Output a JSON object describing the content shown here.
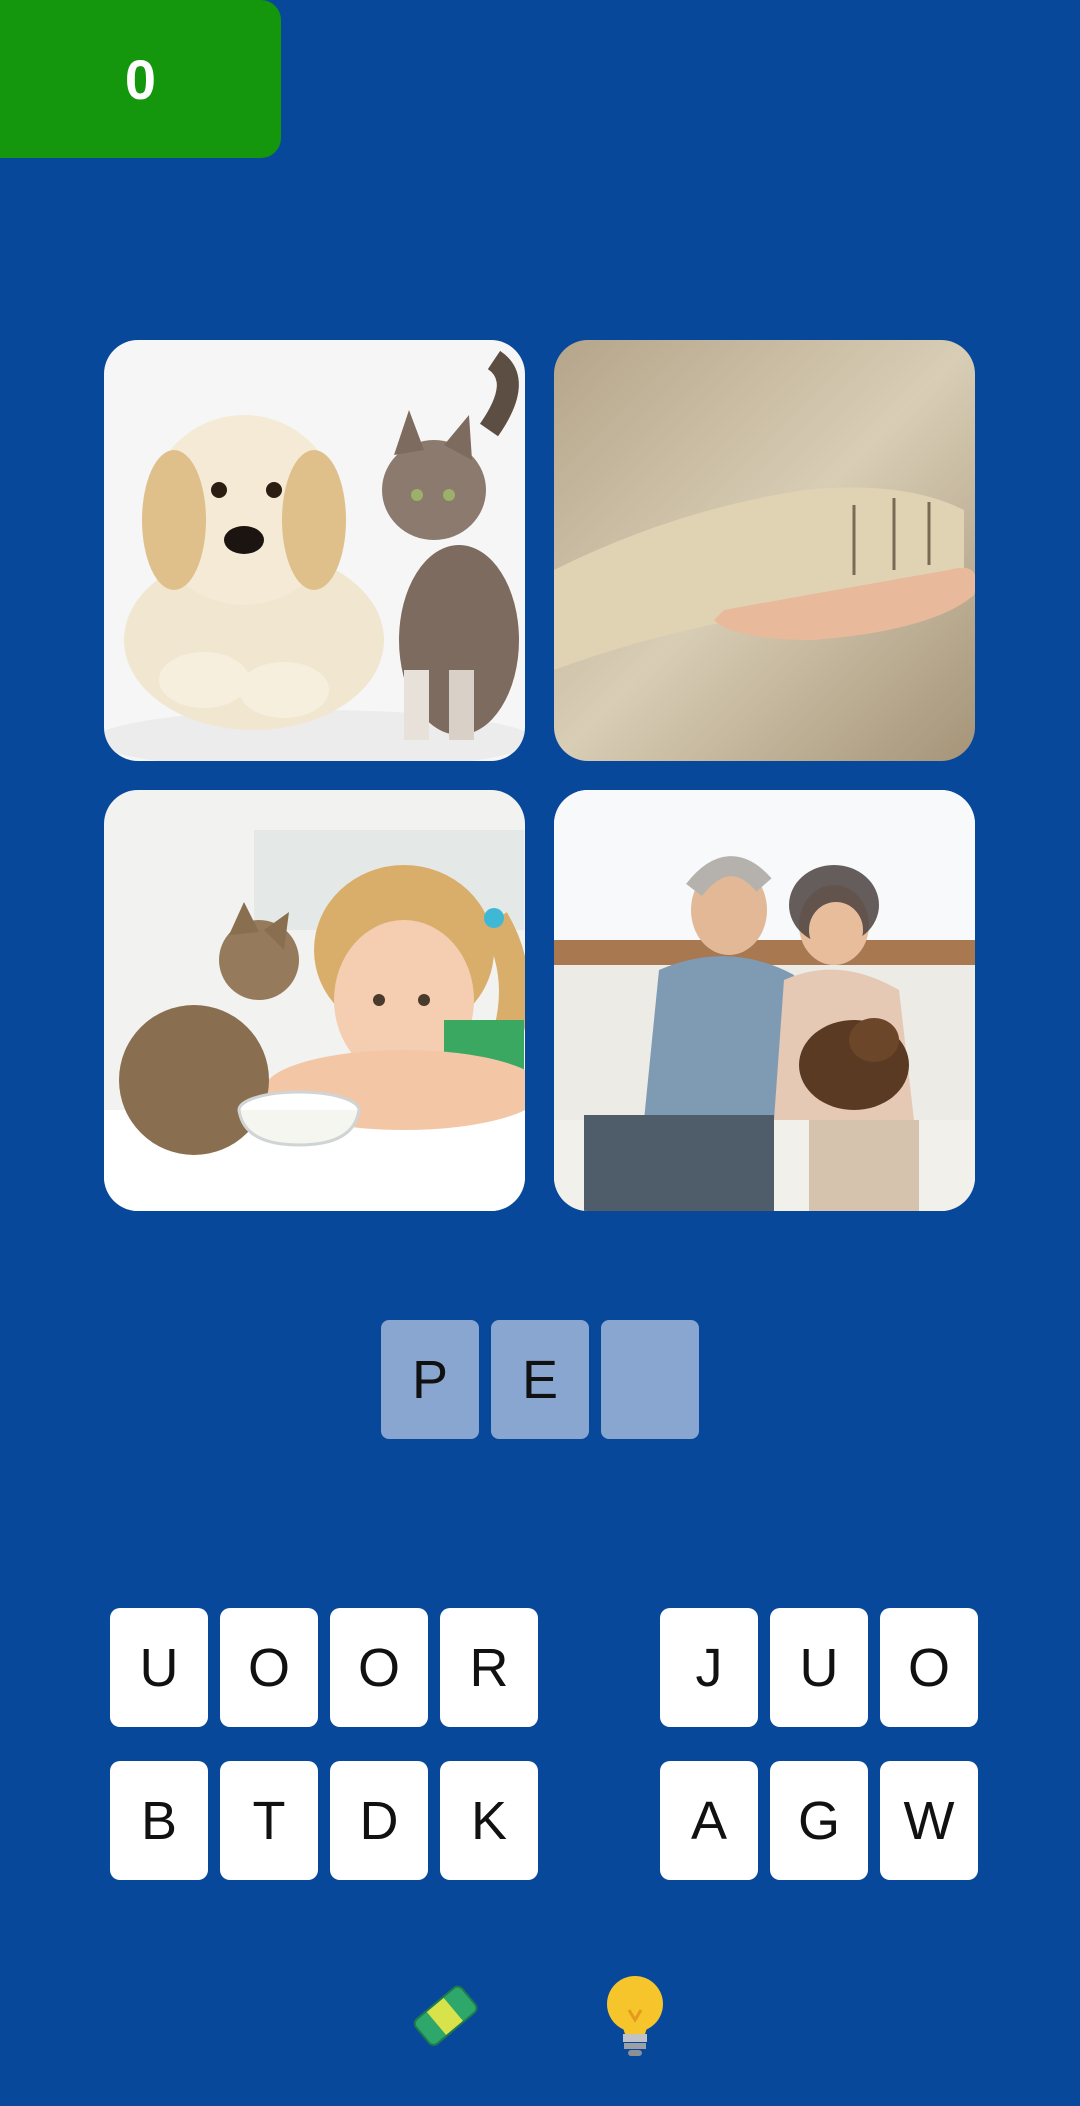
{
  "score": "0",
  "answer_slots": [
    "P",
    "E",
    ""
  ],
  "letter_keys": [
    [
      "U",
      "O",
      "O",
      "R",
      "J",
      "U",
      "O"
    ],
    [
      "B",
      "T",
      "D",
      "K",
      "A",
      "G",
      "W"
    ]
  ],
  "images": [
    {
      "icon": "puppy-and-kitten-photo"
    },
    {
      "icon": "dog-paw-in-hand-photo"
    },
    {
      "icon": "girl-with-kitten-and-milk-photo"
    },
    {
      "icon": "elderly-couple-with-dog-photo"
    }
  ],
  "tools": {
    "eraser": "eraser-icon",
    "hint": "lightbulb-icon"
  },
  "colors": {
    "background": "#07489b",
    "score_badge": "#15970d",
    "slot": "#88a6cf",
    "key": "#ffffff"
  }
}
